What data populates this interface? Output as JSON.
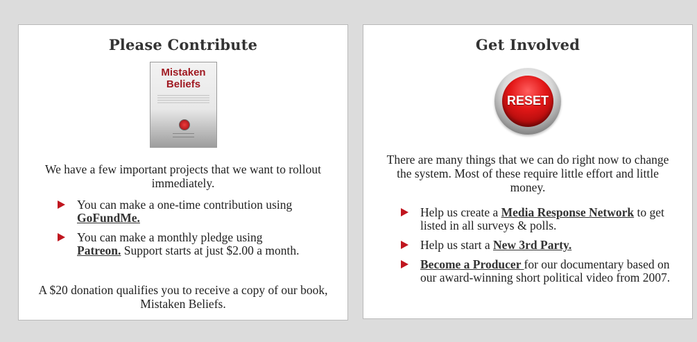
{
  "left_card": {
    "title": "Please Contribute",
    "book": {
      "title_line1": "Mistaken",
      "title_line2": "Beliefs"
    },
    "intro": "We have a few important projects that we want to rollout immediately.",
    "bullets": [
      {
        "before": "You can make a one-time contribution using ",
        "link": "GoFundMe.",
        "after": ""
      },
      {
        "before": "You can make a monthly pledge using ",
        "link": "Patreon.",
        "after": " Support starts at just $2.00 a month."
      }
    ],
    "footer": "A $20 donation qualifies you to receive a copy of our book, Mistaken Beliefs."
  },
  "right_card": {
    "title": "Get Involved",
    "reset_label": "RESET",
    "intro": "There are many things that we can do right now to change the system. Most of these require little effort and little money.",
    "bullets": [
      {
        "before": "Help us create a ",
        "link": "Media Response Network",
        "after": " to get listed in all surveys & polls."
      },
      {
        "before": "Help us start a ",
        "link": "New 3rd Party.",
        "after": ""
      },
      {
        "before": "",
        "link": "Become a Producer ",
        "after": "for our documentary based on our award-winning short political video from 2007."
      }
    ]
  },
  "colors": {
    "accent": "#c0161f",
    "background": "#dcdcdc"
  }
}
